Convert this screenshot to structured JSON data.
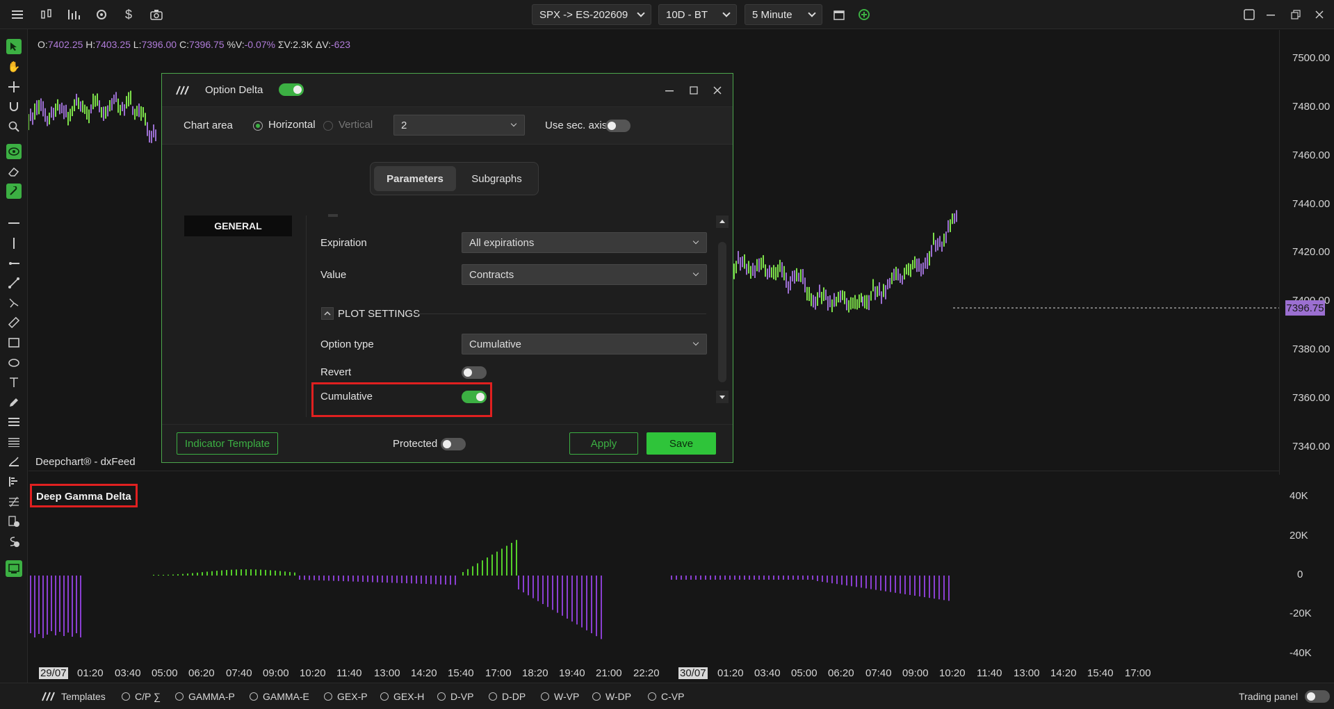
{
  "topbar": {
    "symbol": "SPX -> ES-202609",
    "period": "10D - BT",
    "interval": "5 Minute"
  },
  "ohlc": {
    "o_label": "O:",
    "o": "7402.25",
    "h_label": "H:",
    "h": "7403.25",
    "l_label": "L:",
    "l": "7396.00",
    "c_label": "C:",
    "c": "7396.75",
    "pv_label": "%V:",
    "pv": "-0.07%",
    "sv_label": "ΣV:",
    "sv": "2.3K",
    "dv_label": "ΔV:",
    "dv": "-623"
  },
  "price_axis": [
    "7500.00",
    "7480.00",
    "7460.00",
    "7440.00",
    "7420.00",
    "7400.00",
    "7380.00",
    "7360.00",
    "7340.00"
  ],
  "last_price": "7396.75",
  "watermark": "Deepchart® - dxFeed",
  "lower_panel": {
    "title": "Deep Gamma Delta",
    "axis": [
      "40K",
      "20K",
      "0",
      "-20K",
      "-40K"
    ]
  },
  "time_axis": [
    "29/07",
    "01:20",
    "03:40",
    "05:00",
    "06:20",
    "07:40",
    "09:00",
    "10:20",
    "11:40",
    "13:00",
    "14:20",
    "15:40",
    "17:00",
    "18:20",
    "19:40",
    "21:00",
    "22:20",
    "30/07",
    "01:20",
    "03:40",
    "05:00",
    "06:20",
    "07:40",
    "09:00",
    "10:20",
    "11:40",
    "13:00",
    "14:20",
    "15:40",
    "17:00"
  ],
  "dialog": {
    "title": "Option Delta",
    "chart_area_label": "Chart area",
    "horizontal_label": "Horizontal",
    "vertical_label": "Vertical",
    "chart_area_value": "2",
    "sec_axis_label": "Use sec. axis",
    "tab_parameters": "Parameters",
    "tab_subgraphs": "Subgraphs",
    "general": "GENERAL",
    "expiration_label": "Expiration",
    "expiration_value": "All expirations",
    "value_label": "Value",
    "value_value": "Contracts",
    "plot_settings": "PLOT SETTINGS",
    "option_type_label": "Option type",
    "option_type_value": "Cumulative",
    "revert_label": "Revert",
    "cumulative_label": "Cumulative",
    "indicator_template": "Indicator Template",
    "protected_label": "Protected",
    "apply": "Apply",
    "save": "Save"
  },
  "bottombar": {
    "templates": "Templates",
    "items": [
      "C/P ∑",
      "GAMMA-P",
      "GAMMA-E",
      "GEX-P",
      "GEX-H",
      "D-VP",
      "D-DP",
      "W-VP",
      "W-DP",
      "C-VP"
    ],
    "trading_panel": "Trading panel"
  },
  "colors": {
    "accent": "#3cb043",
    "purple": "#9b6fd1",
    "bg": "#161616"
  }
}
